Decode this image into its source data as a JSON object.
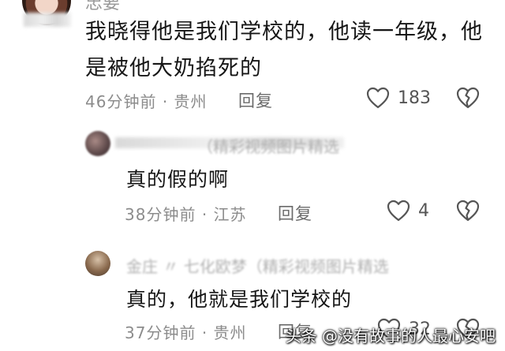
{
  "comment_main": {
    "username": "忠要",
    "text_line1": "我晓得他是我们学校的，他读一年级，他",
    "text_line2": "是被他大奶掐死的",
    "time": "46分钟前",
    "location": "贵州",
    "reply_label": "回复",
    "likes": "183"
  },
  "reply1": {
    "username_blurred": "（精彩视频图片精选",
    "text": "真的假的啊",
    "time": "38分钟前",
    "location": "江苏",
    "reply_label": "回复",
    "likes": "4"
  },
  "reply2": {
    "username_blurred": "金庄  〃 七化欧梦（精彩视频图片精选",
    "text": "真的，他就是我们学校的",
    "time": "37分钟前",
    "location": "贵州",
    "reply_label": "回复",
    "likes": "32"
  },
  "watermark": "头条 @没有故事的人最心安吧",
  "separator": "·"
}
